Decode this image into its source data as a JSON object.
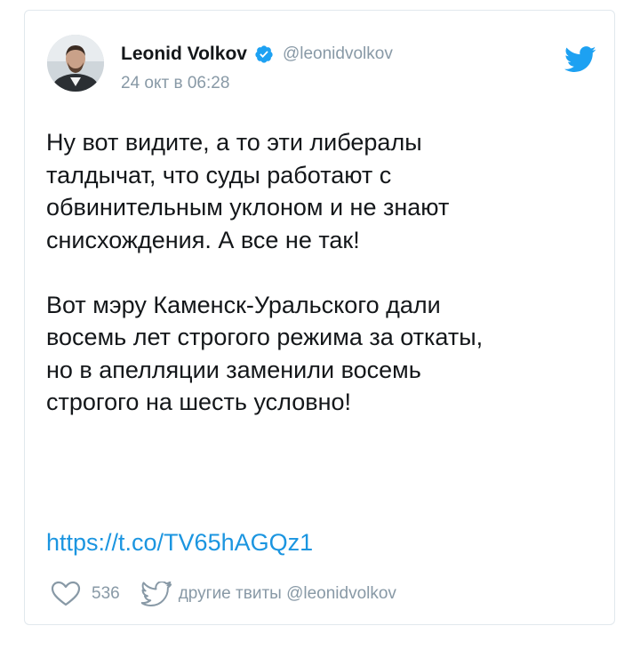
{
  "tweet": {
    "display_name": "Leonid Volkov",
    "handle": "@leonidvolkov",
    "timestamp": "24 окт в 06:28",
    "paragraphs": [
      [
        "Ну вот видите, а то эти либералы",
        "талдычат, что суды работают с",
        "обвинительным уклоном и не знают",
        "снисхождения. А все не так!"
      ],
      [
        "Вот мэру Каменск-Уральского дали",
        "восемь лет строгого режима за откаты,",
        "но в апелляции заменили восемь",
        "строгого на шесть условно!"
      ]
    ],
    "link": "https://t.co/TV65hAGQz1",
    "likes": "536",
    "more_tweets_label": "другие твиты @leonidvolkov"
  },
  "icons": {
    "verified": "verified-badge-icon",
    "brand": "twitter-bird-icon",
    "like": "heart-icon",
    "more": "bird-outline-icon"
  },
  "colors": {
    "accent": "#1da1f2",
    "link": "#1b95e0",
    "muted": "#8899a6",
    "text": "#14171a",
    "border": "#e1e8ed"
  }
}
